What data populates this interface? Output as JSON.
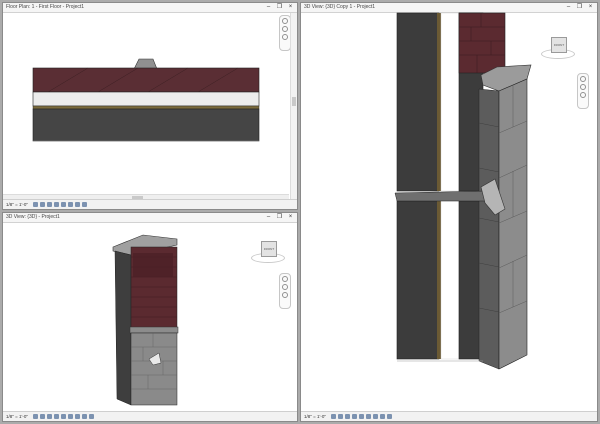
{
  "panes": {
    "floor_plan": {
      "title": "Floor Plan: 1 - First Floor - Project1",
      "scale": "1/8\" = 1'-0\""
    },
    "view_3d": {
      "title": "3D View: {3D} - Project1",
      "scale": "1/8\" = 1'-0\""
    },
    "view_3d_copy": {
      "title": "3D View: {3D} Copy 1 - Project1",
      "scale": "1/8\" = 1'-0\""
    }
  },
  "window_buttons": {
    "minimize": "–",
    "restore": "❐",
    "close": "×"
  },
  "viewcube": {
    "label": "FRONT"
  },
  "icons": [
    "minimize-icon",
    "restore-icon",
    "close-icon",
    "viewcube-icon",
    "navigation-wheel-icon",
    "zoom-icon",
    "pan-icon"
  ],
  "colors": {
    "brick": "#5b2a30",
    "stone": "#7b7b7b",
    "dark_wall": "#3f3f3f",
    "cap": "#9b9b9b"
  }
}
